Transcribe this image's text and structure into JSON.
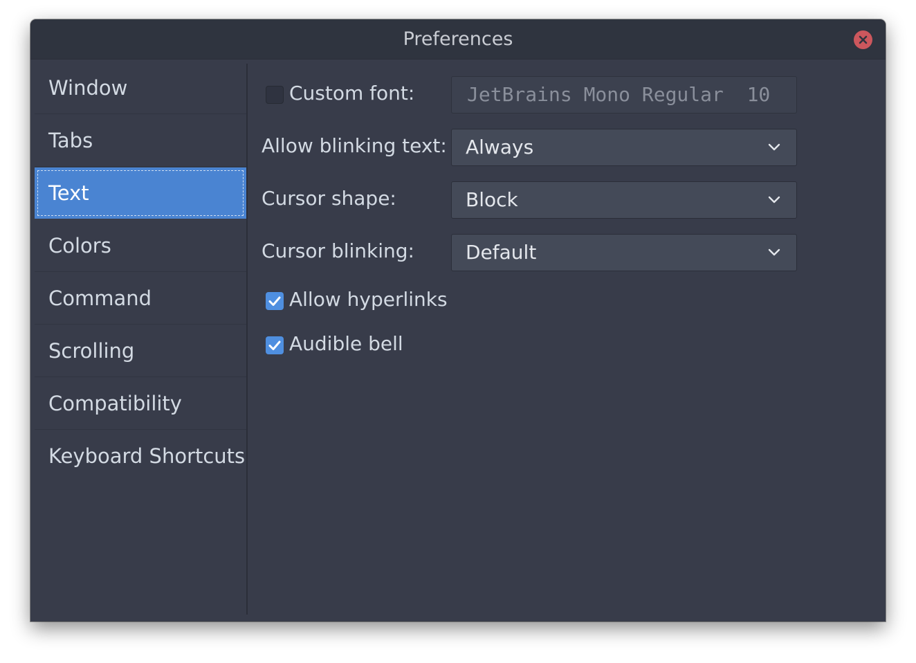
{
  "window": {
    "title": "Preferences"
  },
  "sidebar": {
    "items": [
      {
        "label": "Window"
      },
      {
        "label": "Tabs"
      },
      {
        "label": "Text",
        "selected": true
      },
      {
        "label": "Colors"
      },
      {
        "label": "Command"
      },
      {
        "label": "Scrolling"
      },
      {
        "label": "Compatibility"
      },
      {
        "label": "Keyboard Shortcuts"
      }
    ]
  },
  "text_page": {
    "custom_font": {
      "label": "Custom font:",
      "checked": false,
      "font_value": "JetBrains Mono Regular  10"
    },
    "blinking_text": {
      "label": "Allow blinking text:",
      "value": "Always"
    },
    "cursor_shape": {
      "label": "Cursor shape:",
      "value": "Block"
    },
    "cursor_blinking": {
      "label": "Cursor blinking:",
      "value": "Default"
    },
    "allow_hyperlinks": {
      "label": "Allow hyperlinks",
      "checked": true
    },
    "audible_bell": {
      "label": "Audible bell",
      "checked": true
    }
  },
  "colors": {
    "window_bg": "#383c4a",
    "titlebar_bg": "#2f343f",
    "accent": "#4a84d2",
    "close_button": "#cc575d"
  }
}
